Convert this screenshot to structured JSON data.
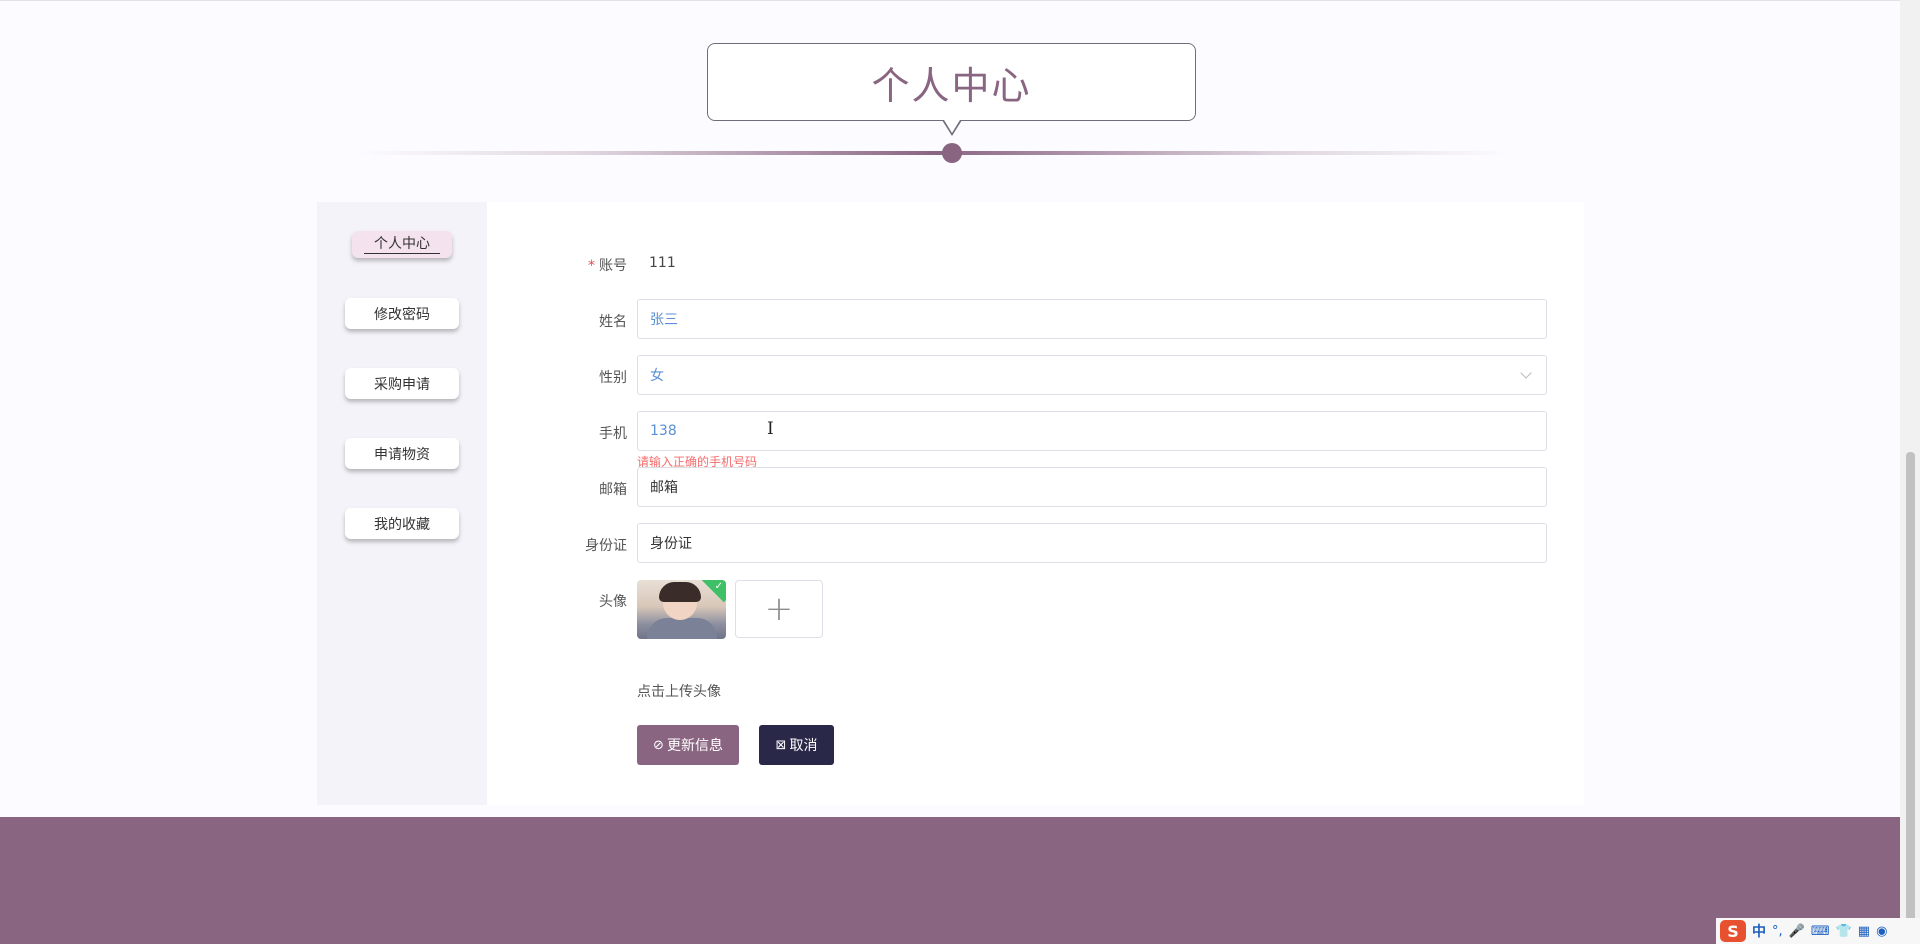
{
  "header": {
    "title": "个人中心"
  },
  "sidebar": {
    "items": [
      {
        "label": "个人中心",
        "active": true
      },
      {
        "label": "修改密码",
        "active": false
      },
      {
        "label": "采购申请",
        "active": false
      },
      {
        "label": "申请物资",
        "active": false
      },
      {
        "label": "我的收藏",
        "active": false
      }
    ]
  },
  "form": {
    "account": {
      "label": "账号",
      "required_mark": "*",
      "value": "111"
    },
    "name": {
      "label": "姓名",
      "value": "张三"
    },
    "gender": {
      "label": "性别",
      "value": "女"
    },
    "phone": {
      "label": "手机",
      "value": "138",
      "error": "请输入正确的手机号码"
    },
    "email": {
      "label": "邮箱",
      "value": "邮箱"
    },
    "id_card": {
      "label": "身份证",
      "value": "身份证"
    },
    "avatar": {
      "label": "头像",
      "upload_plus": "+",
      "hint": "点击上传头像"
    }
  },
  "actions": {
    "update_label": "更新信息",
    "update_icon": "check-circle-icon",
    "cancel_label": "取消",
    "cancel_icon": "close-square-icon"
  },
  "ime": {
    "logo": "S",
    "mode": "中"
  },
  "colors": {
    "brand": "#8a6582",
    "dark": "#2a2848",
    "error": "#f56c6c",
    "input_value": "#5b8fd6"
  }
}
